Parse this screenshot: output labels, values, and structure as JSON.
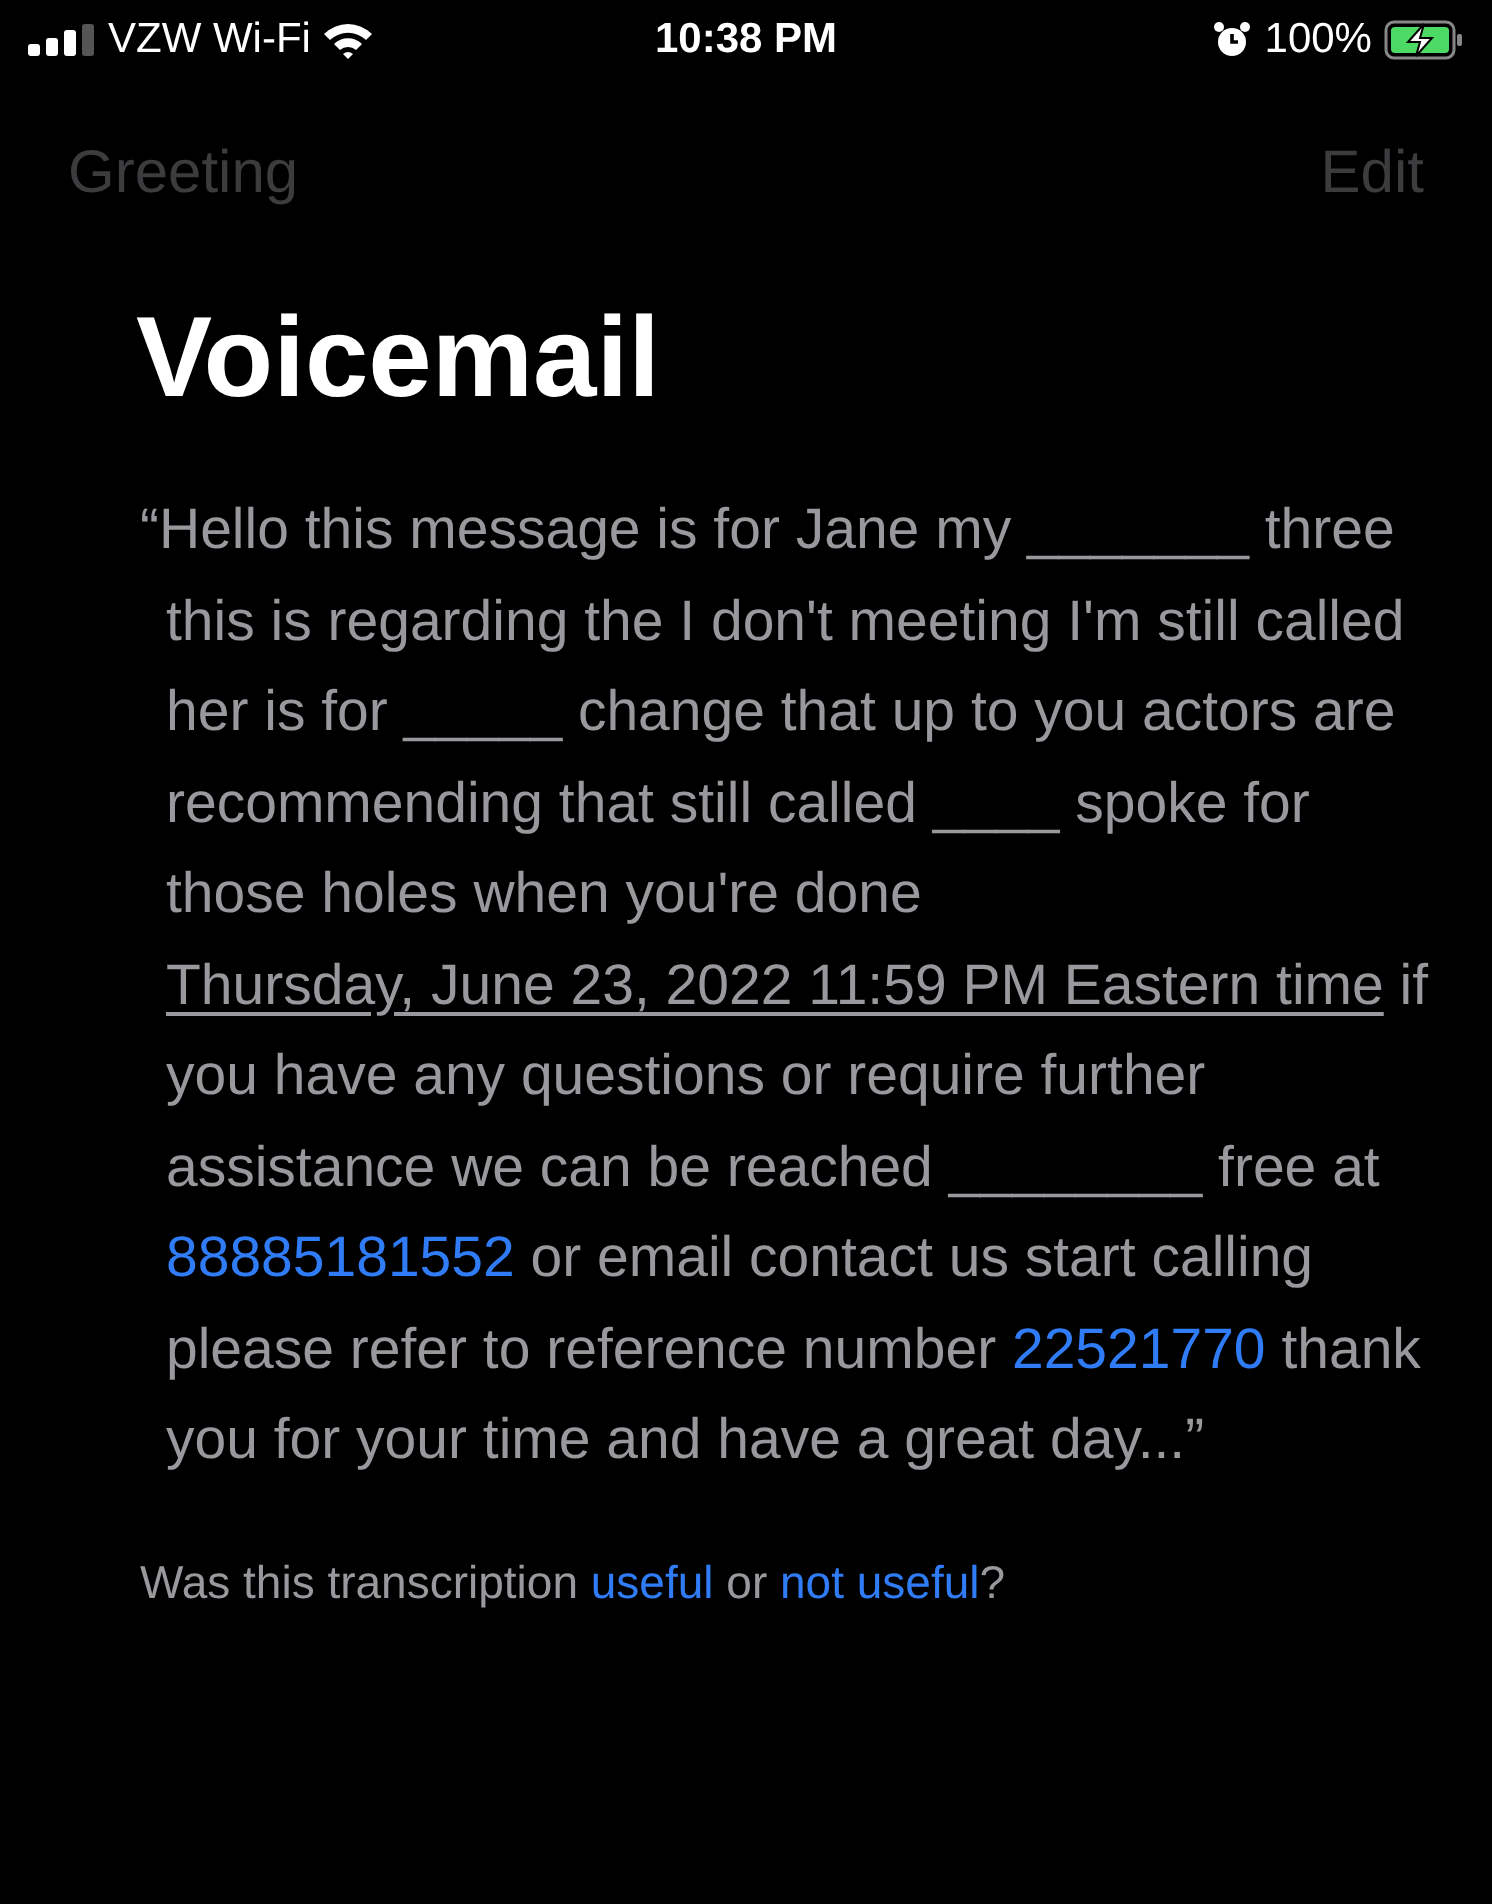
{
  "status_bar": {
    "carrier": "VZW Wi-Fi",
    "time": "10:38 PM",
    "battery": "100%",
    "charging": true
  },
  "nav": {
    "left": {
      "label": "Greeting",
      "disabled": true
    },
    "right": {
      "label": "Edit",
      "disabled": true
    }
  },
  "title": "Voicemail",
  "transcript": [
    {
      "kind": "text",
      "text": "“Hello this message is for Jane my _______ three this is regarding the I don't meeting I'm still called her is for _____ change that up to you actors are recommending that still called ____ spoke for those holes when you're done "
    },
    {
      "kind": "date",
      "text": "Thursday, June 23, 2022 11:59 PM Eastern time"
    },
    {
      "kind": "text",
      "text": " if you have any questions or require further assistance we can be reached ________ free at "
    },
    {
      "kind": "link",
      "text": "88885181552"
    },
    {
      "kind": "text",
      "text": " or email contact us start calling please refer to reference number "
    },
    {
      "kind": "link",
      "text": "22521770"
    },
    {
      "kind": "text",
      "text": " thank you for your time and have a great day...”"
    }
  ],
  "feedback": [
    {
      "kind": "text",
      "text": "Was this transcription "
    },
    {
      "kind": "link",
      "text": "useful"
    },
    {
      "kind": "text",
      "text": " or "
    },
    {
      "kind": "link",
      "text": "not useful"
    },
    {
      "kind": "text",
      "text": "?"
    }
  ]
}
